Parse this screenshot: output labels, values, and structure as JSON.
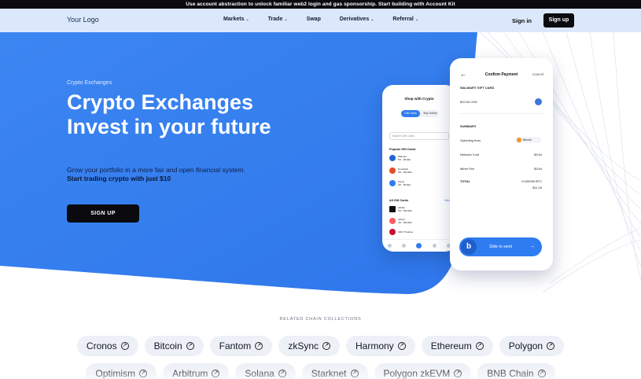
{
  "announcement": "Use account abstraction to unlock familiar web2 login and gas sponsorship. Start building with Account Kit",
  "nav": {
    "logo": "Your Logo",
    "menu": [
      {
        "label": "Markets",
        "dropdown": true
      },
      {
        "label": "Trade",
        "dropdown": true
      },
      {
        "label": "Swap",
        "dropdown": false
      },
      {
        "label": "Derivatives",
        "dropdown": true
      },
      {
        "label": "Referral",
        "dropdown": true
      }
    ],
    "signin": "Sign in",
    "signup": "Sign up"
  },
  "hero": {
    "eyebrow": "Crypto Exchanges",
    "headline": "Crypto Exchanges Invest in your future",
    "sub1": "Grow your portfolio in a more fair and open financial system.",
    "sub2": "Start trading crypto with just $10",
    "cta": "SIGN UP"
  },
  "phone_left": {
    "title": "Shop with Crypto",
    "tab_active": "Gift Cards",
    "tab_inactive": "Buy Online",
    "search_placeholder": "Search Gift Cards",
    "popular_title": "Popular Gift Cards",
    "popular": [
      {
        "name": "Walmart",
        "sub": "5% · $5-$1k",
        "color": "#1f66d1"
      },
      {
        "name": "Doordash",
        "sub": "5% · $15-$1k",
        "color": "#e84a27"
      },
      {
        "name": "Game",
        "sub": "4% · $5-$1k",
        "color": "#2f7cf0"
      }
    ],
    "all_title": "All Gift Cards",
    "all_link": "View",
    "all": [
      {
        "name": "adidas",
        "sub": "5% · $15-$1k",
        "color": "#111111"
      },
      {
        "name": "Airbnb",
        "sub": "4% · $25-$1k",
        "color": "#ff5a5f"
      },
      {
        "name": "AMC Theatres",
        "sub": "",
        "color": "#c8102e"
      }
    ]
  },
  "phone_right": {
    "title": "Confirm Payment",
    "cancel": "Cancel",
    "card_label": "WALMART GIFT CARD",
    "amount": "$10.00 USD",
    "summary_title": "SUMMARY",
    "spending_label": "Spending from",
    "spending_value": "Bitcoin",
    "network_label": "Network Cost",
    "network_value": "$3.64",
    "miner_label": "Miner Fee",
    "miner_value": "$3.64",
    "total_label": "TOTAL",
    "total_btc": "0.000296 BTC",
    "total_usd": "$11.16",
    "slide_label": "Slide to send",
    "slide_knob": "b",
    "back": "←"
  },
  "related": {
    "title": "RELATED CHAIN COLLECTIONS",
    "row1": [
      "Cronos",
      "Bitcoin",
      "Fantom",
      "zkSync",
      "Harmony",
      "Ethereum",
      "Polygon"
    ],
    "row2": [
      "Optimism",
      "Arbitrum",
      "Solana",
      "Starknet",
      "Polygon zkEVM",
      "BNB Chain"
    ]
  },
  "colors": {
    "hero_blue": "#2f7cf0",
    "nav_bg": "#dbe8fb",
    "dark": "#0b0b0f"
  }
}
